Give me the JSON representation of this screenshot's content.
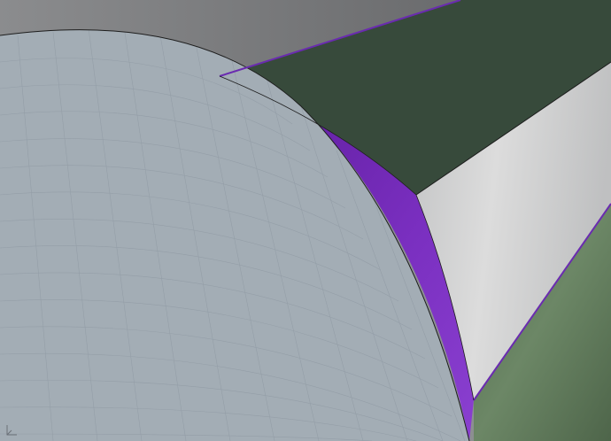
{
  "viewport": {
    "kind": "3d-cad-viewport",
    "background_color": "#8c8f91"
  },
  "surfaces": {
    "top_face": {
      "color": "#6d6e70"
    },
    "curved_face": {
      "color": "#a3adb5",
      "grid_color": "#8e98a2",
      "grid": true
    },
    "dark_green_face": {
      "color": "#374a3b"
    },
    "light_green_face": {
      "color": "#5e7658"
    },
    "bevel_face": {
      "color": "#cfd0d0"
    },
    "fillet_highlight": {
      "color": "#7a2fc0"
    },
    "edge_highlight": {
      "color": "#6a2bb0"
    },
    "edge_line": {
      "color": "#1d1d1d"
    }
  },
  "gizmo": {
    "icon": "axis-triad-icon",
    "color": "#6b7178"
  }
}
